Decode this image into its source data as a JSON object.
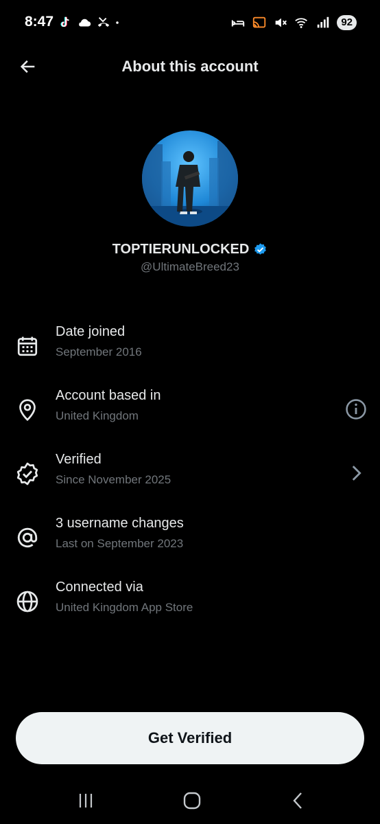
{
  "status_bar": {
    "time": "8:47",
    "battery": "92",
    "left_icons": [
      "tiktok-icon",
      "cloud-icon",
      "missed-call-icon",
      "dot-icon"
    ],
    "right_icons": [
      "sleep-icon",
      "cast-icon",
      "mute-icon",
      "wifi-icon",
      "signal-icon"
    ]
  },
  "header": {
    "back_icon": "arrow-left-icon",
    "title": "About this account"
  },
  "profile": {
    "display_name": "TOPTIERUNLOCKED",
    "handle": "@UltimateBreed23",
    "verified_color": "#1d9bf0"
  },
  "rows": [
    {
      "icon": "calendar-icon",
      "title": "Date joined",
      "subtitle": "September 2016"
    },
    {
      "icon": "location-pin-icon",
      "title": "Account based in",
      "subtitle": "United Kingdom",
      "action_icon": "info-icon"
    },
    {
      "icon": "verified-badge-outline-icon",
      "title": "Verified",
      "subtitle": "Since November 2025",
      "action_icon": "chevron-right-icon"
    },
    {
      "icon": "at-sign-icon",
      "title": "3 username changes",
      "subtitle": "Last on September 2023"
    },
    {
      "icon": "globe-icon",
      "title": "Connected via",
      "subtitle": "United Kingdom App Store"
    }
  ],
  "cta": {
    "label": "Get Verified"
  },
  "nav": {
    "icons": [
      "recent-apps-icon",
      "home-icon",
      "back-icon"
    ]
  }
}
